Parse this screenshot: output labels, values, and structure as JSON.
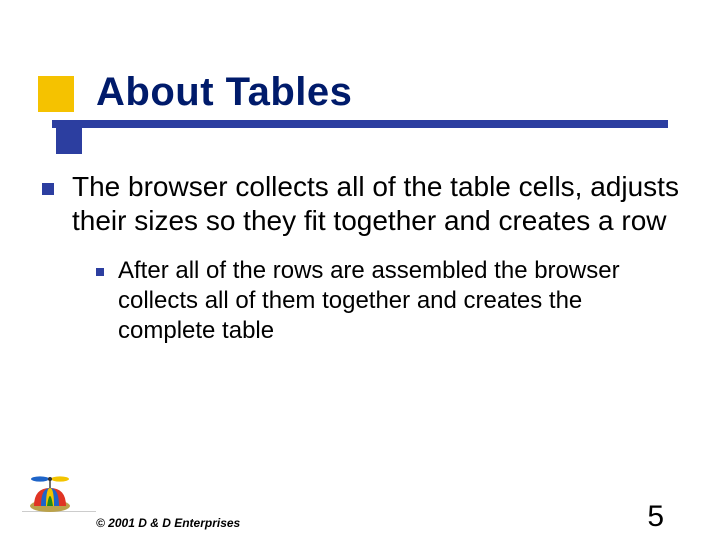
{
  "title": "About Tables",
  "bullets": {
    "level1": "The browser collects all of the table cells, adjusts their sizes so they fit together and creates a row",
    "level2": "After all of the rows are assembled the browser collects all of them together and creates the complete table"
  },
  "footer": {
    "copyright": "© 2001 D & D Enterprises",
    "page_number": "5"
  }
}
